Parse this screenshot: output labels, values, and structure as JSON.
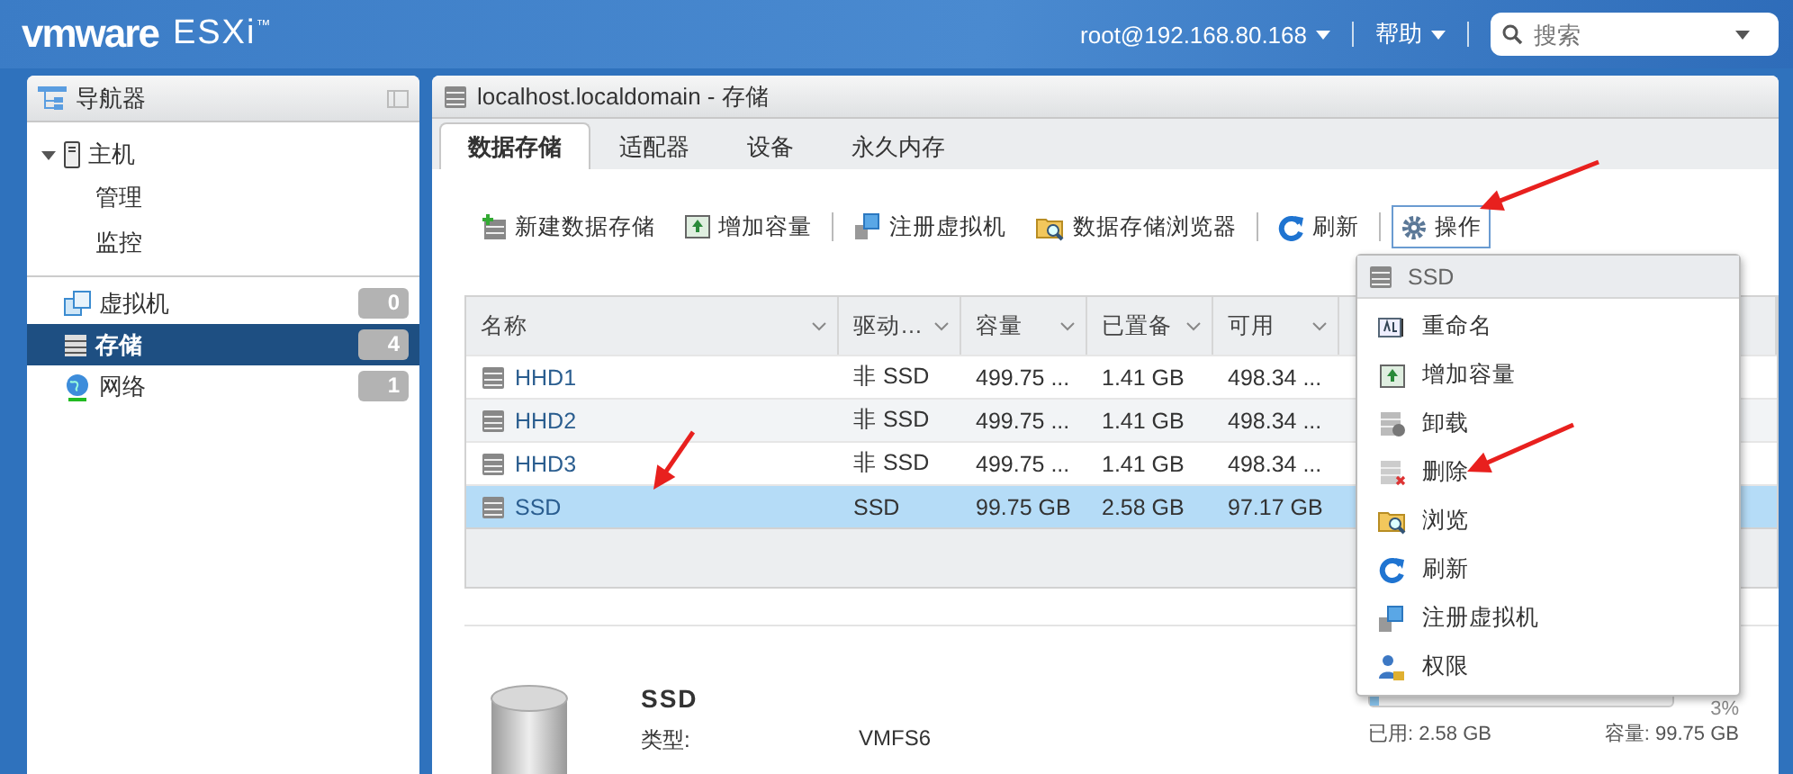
{
  "header": {
    "brand": "vmware",
    "product": "ESXi$^{™}$",
    "user_menu": "root@192.168.80.168",
    "help_menu": "帮助",
    "search": {
      "placeholder": "搜索"
    }
  },
  "navigator": {
    "title": "导航器",
    "tree": [
      {
        "label": "主机",
        "kind": "host",
        "expanded": true,
        "children": [
          {
            "label": "管理"
          },
          {
            "label": "监控"
          }
        ]
      }
    ],
    "items": [
      {
        "label": "虚拟机",
        "kind": "vm",
        "count": "0",
        "selected": false
      },
      {
        "label": "存储",
        "kind": "storage",
        "count": "4",
        "selected": true
      },
      {
        "label": "网络",
        "kind": "network",
        "count": "1",
        "selected": false
      }
    ]
  },
  "main": {
    "title": "localhost.localdomain - 存储",
    "tabs": [
      {
        "label": "数据存储",
        "selected": true
      },
      {
        "label": "适配器",
        "selected": false
      },
      {
        "label": "设备",
        "selected": false
      },
      {
        "label": "永久内存",
        "selected": false
      }
    ],
    "toolbar": [
      {
        "label": "新建数据存储",
        "kind": "new"
      },
      {
        "label": "增加容量",
        "kind": "grow"
      },
      {
        "label": "注册虚拟机",
        "kind": "register"
      },
      {
        "label": "数据存储浏览器",
        "kind": "browse"
      },
      {
        "label": "刷新",
        "kind": "refresh"
      },
      {
        "label": "操作",
        "kind": "actions",
        "selected": true
      }
    ],
    "table": {
      "columns": [
        "名称",
        "驱动…",
        "容量",
        "已置备",
        "可用"
      ],
      "rows": [
        {
          "cells": [
            "HHD1",
            "非 SSD",
            "499.75 ...",
            "1.41 GB",
            "498.34 ..."
          ],
          "selected": false
        },
        {
          "cells": [
            "HHD2",
            "非 SSD",
            "499.75 ...",
            "1.41 GB",
            "498.34 ..."
          ],
          "selected": false
        },
        {
          "cells": [
            "HHD3",
            "非 SSD",
            "499.75 ...",
            "1.41 GB",
            "498.34 ..."
          ],
          "selected": false
        },
        {
          "cells": [
            "SSD",
            "SSD",
            "99.75 GB",
            "2.58 GB",
            "97.17 GB"
          ],
          "selected": true
        }
      ]
    },
    "details": {
      "name": "SSD",
      "fields": [
        {
          "label": "类型:",
          "value": "VMFS6"
        }
      ],
      "usage": {
        "level": 0.03,
        "percent": "3%",
        "used": "已用: 2.58 GB",
        "capacity": "容量: 99.75 GB"
      }
    },
    "context_menu": {
      "header": "SSD",
      "items": [
        {
          "label": "重命名",
          "kind": "rename"
        },
        {
          "label": "增加容量",
          "kind": "grow"
        },
        {
          "label": "卸载",
          "kind": "unmount"
        },
        {
          "label": "删除",
          "kind": "delete"
        },
        {
          "label": "浏览",
          "kind": "browse"
        },
        {
          "label": "刷新",
          "kind": "refresh"
        },
        {
          "label": "注册虚拟机",
          "kind": "register"
        },
        {
          "label": "权限",
          "kind": "permissions"
        }
      ]
    }
  }
}
